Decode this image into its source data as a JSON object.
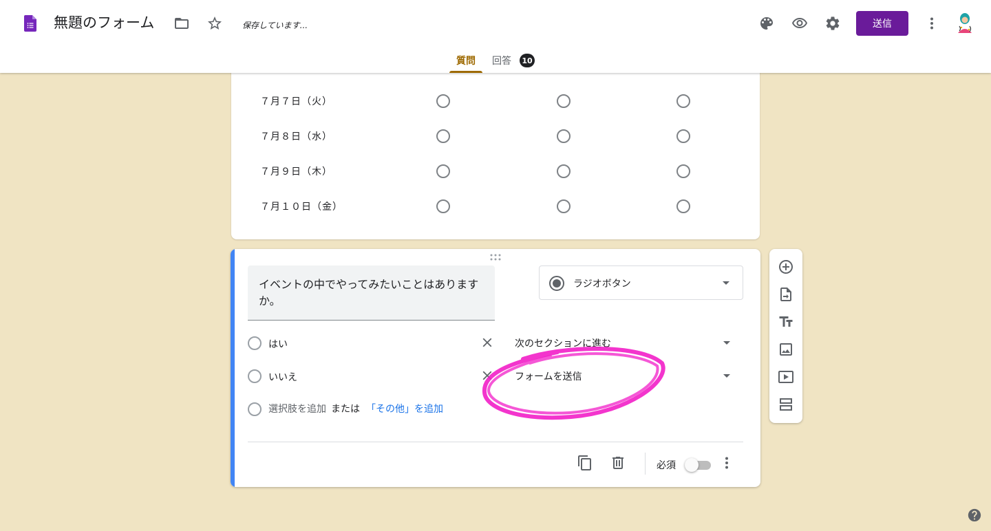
{
  "header": {
    "title": "無題のフォーム",
    "saving_status": "保存しています...",
    "send_label": "送信",
    "accent_color": "#6a1b9a",
    "icons": [
      "forms-logo-icon",
      "folder-icon",
      "star-icon",
      "palette-icon",
      "preview-eye-icon",
      "settings-gear-icon",
      "more-vert-icon",
      "avatar"
    ]
  },
  "tabs": [
    {
      "label": "質問",
      "active": true
    },
    {
      "label": "回答",
      "badge": "10",
      "active": false
    }
  ],
  "grid_question": {
    "rows": [
      "７月７日（火）",
      "７月８日（水）",
      "７月９日（木）",
      "７月１０日（金）"
    ],
    "columns_count": 3
  },
  "active_question": {
    "text": "イベントの中でやってみたいことはありますか。",
    "type_label": "ラジオボタン",
    "options": [
      {
        "label": "はい",
        "navigation": "次のセクションに進む"
      },
      {
        "label": "いいえ",
        "navigation": "フォームを送信"
      }
    ],
    "add_option_label": "選択肢を追加",
    "or_label": "または",
    "add_other_label": "「その他」を追加",
    "required_label": "必須",
    "required_on": false,
    "bar_color": "#4285f4"
  },
  "toolbar": {
    "icons": [
      "add-question-icon",
      "import-questions-icon",
      "add-title-icon",
      "add-image-icon",
      "add-video-icon",
      "add-section-icon"
    ]
  },
  "annotation": {
    "color": "#f21fc8"
  }
}
